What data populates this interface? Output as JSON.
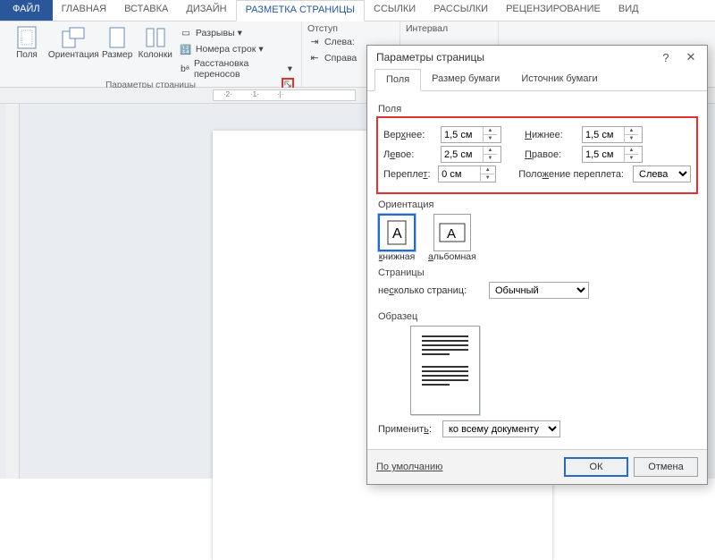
{
  "tabs": {
    "file": "ФАЙЛ",
    "home": "ГЛАВНАЯ",
    "insert": "ВСТАВКА",
    "design": "ДИЗАЙН",
    "layout": "РАЗМЕТКА СТРАНИЦЫ",
    "references": "ССЫЛКИ",
    "mailings": "РАССЫЛКИ",
    "review": "РЕЦЕНЗИРОВАНИЕ",
    "view": "ВИД"
  },
  "ribbon": {
    "margins": "Поля",
    "orientation": "Ориентация",
    "size": "Размер",
    "columns": "Колонки",
    "breaks": "Разрывы",
    "lineNumbers": "Номера строк",
    "hyphenation": "Расстановка переносов",
    "groupPageSetup": "Параметры страницы",
    "indent": "Отступ",
    "indentLeft": "Слева:",
    "indentRight": "Справа",
    "spacing": "Интервал"
  },
  "dialog": {
    "title": "Параметры страницы",
    "tabs": {
      "margins": "Поля",
      "paper": "Размер бумаги",
      "source": "Источник бумаги"
    },
    "marginsLabel": "Поля",
    "top": "Верхнее:",
    "topVal": "1,5 см",
    "bottom": "Нижнее:",
    "bottomVal": "1,5 см",
    "left": "Левое:",
    "leftVal": "2,5 см",
    "right": "Правое:",
    "rightVal": "1,5 см",
    "gutter": "Переплет:",
    "gutterVal": "0 см",
    "gutterPos": "Положение переплета:",
    "gutterPosVal": "Слева",
    "orientationLabel": "Ориентация",
    "portrait": "книжная",
    "landscape": "альбомная",
    "pagesLabel": "Страницы",
    "multiPages": "несколько страниц:",
    "multiPagesVal": "Обычный",
    "previewLabel": "Образец",
    "applyTo": "Применить:",
    "applyToVal": "ко всему документу",
    "default": "По умолчанию",
    "ok": "ОК",
    "cancel": "Отмена"
  }
}
